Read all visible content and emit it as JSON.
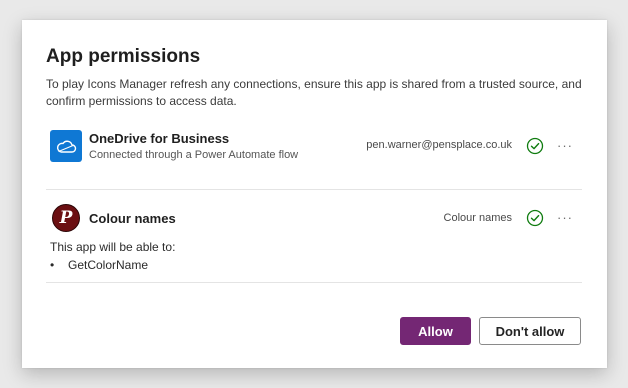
{
  "dialog": {
    "title": "App permissions",
    "description": "To play Icons Manager refresh any connections, ensure this app is shared from a trusted source, and confirm permissions to access data."
  },
  "connections": [
    {
      "name": "OneDrive for Business",
      "subtitle": "Connected through a Power Automate flow",
      "account": "pen.warner@pensplace.co.uk",
      "icon": "onedrive-cloud-icon",
      "status_icon": "check-circle-icon"
    },
    {
      "name": "Colour names",
      "subtitle": "",
      "account": "Colour names",
      "icon": "colour-names-logo-icon",
      "icon_letter": "P",
      "status_icon": "check-circle-icon"
    }
  ],
  "permissions": {
    "intro": "This app will be able to:",
    "items": [
      "GetColorName"
    ]
  },
  "more_label": "···",
  "buttons": {
    "allow": "Allow",
    "deny": "Don't allow"
  },
  "colors": {
    "accent": "#742774",
    "onedrive": "#0f78d4",
    "check": "#107c10",
    "colour_logo": "#6b0f12"
  }
}
